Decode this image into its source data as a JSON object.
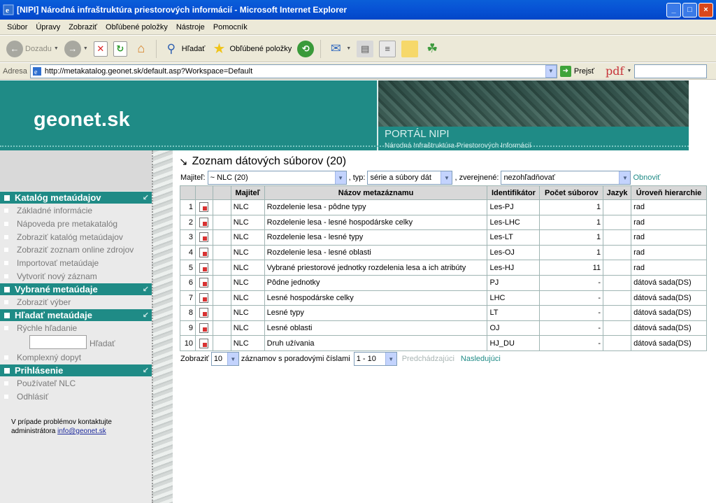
{
  "window": {
    "title": "[NIPI] Národná infraštruktúra priestorových informácií - Microsoft Internet Explorer"
  },
  "menu": [
    "Súbor",
    "Úpravy",
    "Zobraziť",
    "Obľúbené položky",
    "Nástroje",
    "Pomocník"
  ],
  "toolbar": {
    "back_label": "Dozadu",
    "search_label": "Hľadať",
    "favorites_label": "Obľúbené položky"
  },
  "address": {
    "label": "Adresa",
    "url": "http://metakatalog.geonet.sk/default.asp?Workspace=Default",
    "go_label": "Prejsť",
    "pdf_label": "pdf"
  },
  "header": {
    "logo": "geonet.sk",
    "portal_title": "PORTÁL NIPI",
    "portal_subtitle": "Národná Infraštruktúra Priestorových Informácií"
  },
  "sidebar": {
    "sections": [
      {
        "title": "Katalóg metaúdajov",
        "items": [
          "Základné informácie",
          "Nápoveda pre metakatalóg",
          "Zobraziť katalóg metaúdajov",
          "Zobraziť zoznam online zdrojov",
          "Importovať metaúdaje",
          "Vytvoriť nový záznam"
        ]
      },
      {
        "title": "Vybrané metaúdaje",
        "items": [
          "Zobraziť výber"
        ]
      },
      {
        "title": "Hľadať metaúdaje",
        "items": [
          "Rýchle hľadanie",
          "Komplexný dopyt"
        ],
        "search_button": "Hľadať"
      },
      {
        "title": "Prihlásenie",
        "items": [
          "Používateľ NLC",
          "Odhlásiť"
        ]
      }
    ],
    "help_text": "V prípade problémov kontaktujte administrátora",
    "help_email": "info@geonet.sk"
  },
  "main": {
    "title": "Zoznam dátových súborov (20)",
    "filters": {
      "owner_label": "Majiteľ:",
      "owner_value": "~ NLC (20)",
      "type_label": ", typ:",
      "type_value": "série a súbory dát",
      "published_label": ", zverejnené:",
      "published_value": "nezohľadňovať",
      "refresh_label": "Obnoviť"
    },
    "columns": [
      "",
      "",
      "",
      "Majiteľ",
      "Názov metazáznamu",
      "Identifikátor",
      "Počet súborov",
      "Jazyk",
      "Úroveň hierarchie"
    ],
    "rows": [
      {
        "no": "1",
        "owner": "NLC",
        "name": "Rozdelenie lesa - pôdne typy",
        "id": "Les-PJ",
        "count": "1",
        "lang": "",
        "level": "rad"
      },
      {
        "no": "2",
        "owner": "NLC",
        "name": "Rozdelenie lesa - lesné hospodárske celky",
        "id": "Les-LHC",
        "count": "1",
        "lang": "",
        "level": "rad"
      },
      {
        "no": "3",
        "owner": "NLC",
        "name": "Rozdelenie lesa - lesné typy",
        "id": "Les-LT",
        "count": "1",
        "lang": "",
        "level": "rad"
      },
      {
        "no": "4",
        "owner": "NLC",
        "name": "Rozdelenie lesa - lesné oblasti",
        "id": "Les-OJ",
        "count": "1",
        "lang": "",
        "level": "rad"
      },
      {
        "no": "5",
        "owner": "NLC",
        "name": "Vybrané priestorové jednotky rozdelenia lesa a ich atribúty",
        "id": "Les-HJ",
        "count": "11",
        "lang": "",
        "level": "rad"
      },
      {
        "no": "6",
        "owner": "NLC",
        "name": "Pôdne jednotky",
        "id": "PJ",
        "count": "-",
        "lang": "",
        "level": "dátová sada(DS)"
      },
      {
        "no": "7",
        "owner": "NLC",
        "name": "Lesné hospodárske celky",
        "id": "LHC",
        "count": "-",
        "lang": "",
        "level": "dátová sada(DS)"
      },
      {
        "no": "8",
        "owner": "NLC",
        "name": "Lesné typy",
        "id": "LT",
        "count": "-",
        "lang": "",
        "level": "dátová sada(DS)"
      },
      {
        "no": "9",
        "owner": "NLC",
        "name": "Lesné oblasti",
        "id": "OJ",
        "count": "-",
        "lang": "",
        "level": "dátová sada(DS)"
      },
      {
        "no": "10",
        "owner": "NLC",
        "name": "Druh užívania",
        "id": "HJ_DU",
        "count": "-",
        "lang": "",
        "level": "dátová sada(DS)"
      }
    ],
    "pager": {
      "show_label": "Zobraziť",
      "page_size": "10",
      "records_label": "záznamov s poradovými číslami",
      "range": "1 - 10",
      "prev_label": "Predchádzajúci",
      "next_label": "Nasledujúci"
    }
  },
  "colors": {
    "teal": "#1f8b86",
    "xp_blue": "#0854d6"
  }
}
